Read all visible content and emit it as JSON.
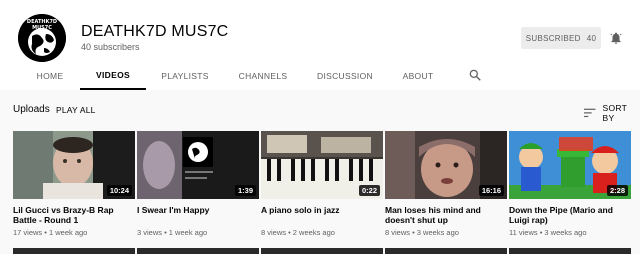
{
  "channel": {
    "avatar_text": "DEATHK7D MUS7C",
    "name": "DEATHK7D MUS7C",
    "subscribers": "40 subscribers",
    "subscribe_label": "SUBSCRIBED",
    "subscribe_count": "40"
  },
  "tabs": [
    {
      "label": "HOME"
    },
    {
      "label": "VIDEOS"
    },
    {
      "label": "PLAYLISTS"
    },
    {
      "label": "CHANNELS"
    },
    {
      "label": "DISCUSSION"
    },
    {
      "label": "ABOUT"
    }
  ],
  "toolbar": {
    "uploads": "Uploads",
    "play_all": "PLAY ALL",
    "sort_by": "SORT BY"
  },
  "videos": [
    {
      "title": "Lil Gucci vs Brazy-B Rap Battle - Round 1",
      "meta": "17 views • 1 week ago",
      "duration": "10:24"
    },
    {
      "title": "I Swear I'm Happy",
      "meta": "3 views • 1 week ago",
      "duration": "1:39"
    },
    {
      "title": "A piano solo in jazz",
      "meta": "8 views • 2 weeks ago",
      "duration": "0:22"
    },
    {
      "title": "Man loses his mind and doesn't shut up",
      "meta": "8 views • 3 weeks ago",
      "duration": "16:16"
    },
    {
      "title": "Down the Pipe (Mario and Luigi rap)",
      "meta": "11 views • 3 weeks ago",
      "duration": "2:28"
    }
  ],
  "colors": {
    "background": "#f9f9f9",
    "header": "#ffffff",
    "subscribed_bg": "#ececec",
    "text_primary": "#030303",
    "text_secondary": "#606060"
  },
  "icons": {
    "bell": "bell-icon",
    "search": "search-icon",
    "sort": "sort-icon"
  }
}
